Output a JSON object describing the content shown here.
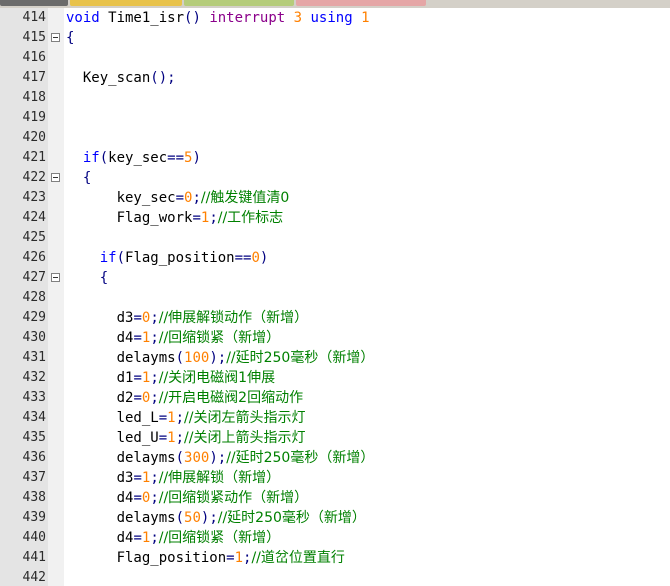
{
  "colors": {
    "keyword": "#0000ff",
    "keyword2": "#8b008b",
    "number": "#ff8000",
    "operator": "#000080",
    "comment": "#008000",
    "text": "#000000",
    "gutter": "#e4e4e4"
  },
  "lines": [
    {
      "n": "414",
      "fold": false,
      "indent": 0,
      "tokens": [
        [
          "kw",
          "void"
        ],
        [
          "id",
          " Time1_isr"
        ],
        [
          "op",
          "()"
        ],
        [
          "id",
          " "
        ],
        [
          "kw2",
          "interrupt"
        ],
        [
          "id",
          " "
        ],
        [
          "num",
          "3"
        ],
        [
          "id",
          " "
        ],
        [
          "kw",
          "using"
        ],
        [
          "id",
          " "
        ],
        [
          "num",
          "1"
        ]
      ]
    },
    {
      "n": "415",
      "fold": true,
      "indent": 0,
      "tokens": [
        [
          "op",
          "{"
        ]
      ]
    },
    {
      "n": "416",
      "fold": false,
      "indent": 0,
      "tokens": []
    },
    {
      "n": "417",
      "fold": false,
      "indent": 2,
      "tokens": [
        [
          "id",
          "Key_scan"
        ],
        [
          "op",
          "();"
        ]
      ]
    },
    {
      "n": "418",
      "fold": false,
      "indent": 0,
      "tokens": []
    },
    {
      "n": "419",
      "fold": false,
      "indent": 0,
      "tokens": []
    },
    {
      "n": "420",
      "fold": false,
      "indent": 0,
      "tokens": []
    },
    {
      "n": "421",
      "fold": false,
      "indent": 2,
      "tokens": [
        [
          "kw",
          "if"
        ],
        [
          "op",
          "("
        ],
        [
          "id",
          "key_sec"
        ],
        [
          "op",
          "=="
        ],
        [
          "num",
          "5"
        ],
        [
          "op",
          ")"
        ]
      ]
    },
    {
      "n": "422",
      "fold": true,
      "indent": 2,
      "tokens": [
        [
          "op",
          "{"
        ]
      ]
    },
    {
      "n": "423",
      "fold": false,
      "indent": 6,
      "tokens": [
        [
          "id",
          "key_sec"
        ],
        [
          "op",
          "="
        ],
        [
          "num",
          "0"
        ],
        [
          "op",
          ";"
        ],
        [
          "cm",
          "//触发键值清0"
        ]
      ]
    },
    {
      "n": "424",
      "fold": false,
      "indent": 6,
      "tokens": [
        [
          "id",
          "Flag_work"
        ],
        [
          "op",
          "="
        ],
        [
          "num",
          "1"
        ],
        [
          "op",
          ";"
        ],
        [
          "cm",
          "//工作标志"
        ]
      ]
    },
    {
      "n": "425",
      "fold": false,
      "indent": 0,
      "tokens": []
    },
    {
      "n": "426",
      "fold": false,
      "indent": 4,
      "tokens": [
        [
          "kw",
          "if"
        ],
        [
          "op",
          "("
        ],
        [
          "id",
          "Flag_position"
        ],
        [
          "op",
          "=="
        ],
        [
          "num",
          "0"
        ],
        [
          "op",
          ")"
        ]
      ]
    },
    {
      "n": "427",
      "fold": true,
      "indent": 4,
      "tokens": [
        [
          "op",
          "{"
        ]
      ]
    },
    {
      "n": "428",
      "fold": false,
      "indent": 0,
      "tokens": []
    },
    {
      "n": "429",
      "fold": false,
      "indent": 6,
      "tokens": [
        [
          "id",
          "d3"
        ],
        [
          "op",
          "="
        ],
        [
          "num",
          "0"
        ],
        [
          "op",
          ";"
        ],
        [
          "cm",
          "//伸展解锁动作（新增）"
        ]
      ]
    },
    {
      "n": "430",
      "fold": false,
      "indent": 6,
      "tokens": [
        [
          "id",
          "d4"
        ],
        [
          "op",
          "="
        ],
        [
          "num",
          "1"
        ],
        [
          "op",
          ";"
        ],
        [
          "cm",
          "//回缩锁紧（新增）"
        ]
      ]
    },
    {
      "n": "431",
      "fold": false,
      "indent": 6,
      "tokens": [
        [
          "id",
          "delayms"
        ],
        [
          "op",
          "("
        ],
        [
          "num",
          "100"
        ],
        [
          "op",
          ");"
        ],
        [
          "cm",
          "//延时250毫秒（新增）"
        ]
      ]
    },
    {
      "n": "432",
      "fold": false,
      "indent": 6,
      "tokens": [
        [
          "id",
          "d1"
        ],
        [
          "op",
          "="
        ],
        [
          "num",
          "1"
        ],
        [
          "op",
          ";"
        ],
        [
          "cm",
          "//关闭电磁阀1伸展"
        ]
      ]
    },
    {
      "n": "433",
      "fold": false,
      "indent": 6,
      "tokens": [
        [
          "id",
          "d2"
        ],
        [
          "op",
          "="
        ],
        [
          "num",
          "0"
        ],
        [
          "op",
          ";"
        ],
        [
          "cm",
          "//开启电磁阀2回缩动作"
        ]
      ]
    },
    {
      "n": "434",
      "fold": false,
      "indent": 6,
      "tokens": [
        [
          "id",
          "led_L"
        ],
        [
          "op",
          "="
        ],
        [
          "num",
          "1"
        ],
        [
          "op",
          ";"
        ],
        [
          "cm",
          "//关闭左箭头指示灯"
        ]
      ]
    },
    {
      "n": "435",
      "fold": false,
      "indent": 6,
      "tokens": [
        [
          "id",
          "led_U"
        ],
        [
          "op",
          "="
        ],
        [
          "num",
          "1"
        ],
        [
          "op",
          ";"
        ],
        [
          "cm",
          "//关闭上箭头指示灯"
        ]
      ]
    },
    {
      "n": "436",
      "fold": false,
      "indent": 6,
      "tokens": [
        [
          "id",
          "delayms"
        ],
        [
          "op",
          "("
        ],
        [
          "num",
          "300"
        ],
        [
          "op",
          ");"
        ],
        [
          "cm",
          "//延时250毫秒（新增）"
        ]
      ]
    },
    {
      "n": "437",
      "fold": false,
      "indent": 6,
      "tokens": [
        [
          "id",
          "d3"
        ],
        [
          "op",
          "="
        ],
        [
          "num",
          "1"
        ],
        [
          "op",
          ";"
        ],
        [
          "cm",
          "//伸展解锁（新增）"
        ]
      ]
    },
    {
      "n": "438",
      "fold": false,
      "indent": 6,
      "tokens": [
        [
          "id",
          "d4"
        ],
        [
          "op",
          "="
        ],
        [
          "num",
          "0"
        ],
        [
          "op",
          ";"
        ],
        [
          "cm",
          "//回缩锁紧动作（新增）"
        ]
      ]
    },
    {
      "n": "439",
      "fold": false,
      "indent": 6,
      "tokens": [
        [
          "id",
          "delayms"
        ],
        [
          "op",
          "("
        ],
        [
          "num",
          "50"
        ],
        [
          "op",
          ");"
        ],
        [
          "cm",
          "//延时250毫秒（新增）"
        ]
      ]
    },
    {
      "n": "440",
      "fold": false,
      "indent": 6,
      "tokens": [
        [
          "id",
          "d4"
        ],
        [
          "op",
          "="
        ],
        [
          "num",
          "1"
        ],
        [
          "op",
          ";"
        ],
        [
          "cm",
          "//回缩锁紧（新增）"
        ]
      ]
    },
    {
      "n": "441",
      "fold": false,
      "indent": 6,
      "tokens": [
        [
          "id",
          "Flag_position"
        ],
        [
          "op",
          "="
        ],
        [
          "num",
          "1"
        ],
        [
          "op",
          ";"
        ],
        [
          "cm",
          "//道岔位置直行"
        ]
      ]
    },
    {
      "n": "442",
      "fold": false,
      "indent": 0,
      "tokens": []
    }
  ]
}
